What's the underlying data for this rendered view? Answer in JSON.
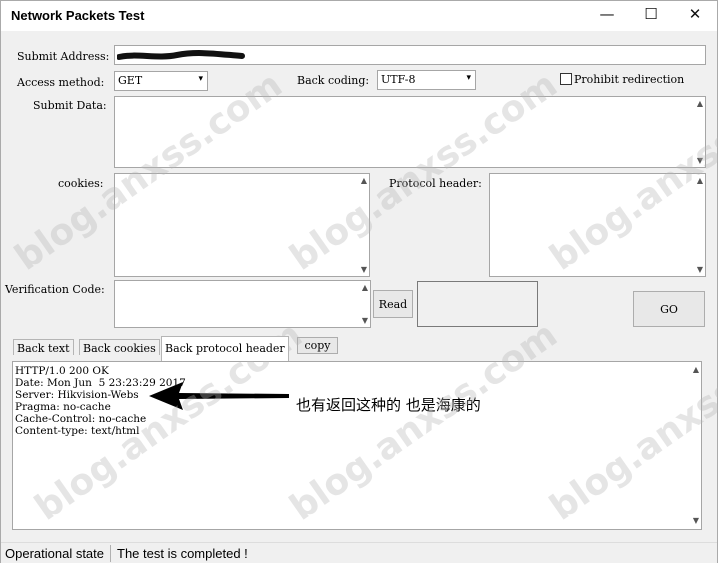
{
  "window": {
    "title": "Network Packets Test",
    "controls": {
      "minimize": "—",
      "maximize": "☐",
      "close": "✕"
    }
  },
  "form": {
    "submit_address_label": "Submit Address:",
    "access_method_label": "Access method:",
    "access_method_value": "GET",
    "back_coding_label": "Back coding:",
    "back_coding_value": "UTF-8",
    "prohibit_redirection_label": "Prohibit redirection",
    "submit_data_label": "Submit Data:",
    "cookies_label": "cookies:",
    "protocol_header_label": "Protocol header:",
    "verification_code_label": "Verification Code:",
    "read_button": "Read",
    "go_button": "GO"
  },
  "tabs": {
    "back_text": "Back text",
    "back_cookies": "Back cookies",
    "back_protocol_header": "Back protocol header",
    "copy": "copy"
  },
  "result": {
    "lines": [
      "HTTP/1.0 200 OK",
      "Date: Mon Jun  5 23:23:29 2017",
      "Server: Hikvision-Webs",
      "Pragma: no-cache",
      "Cache-Control: no-cache",
      "Content-type: text/html"
    ]
  },
  "annotation": "也有返回这种的 也是海康的",
  "watermark": "blog.anxss.com",
  "status": {
    "label": "Operational state",
    "message": "The test is completed !"
  },
  "icons": {
    "dropdown": "chevron-down-icon",
    "scroll_up": "scroll-up-icon",
    "scroll_down": "scroll-down-icon",
    "annotation_arrow": "arrow-left-icon"
  }
}
